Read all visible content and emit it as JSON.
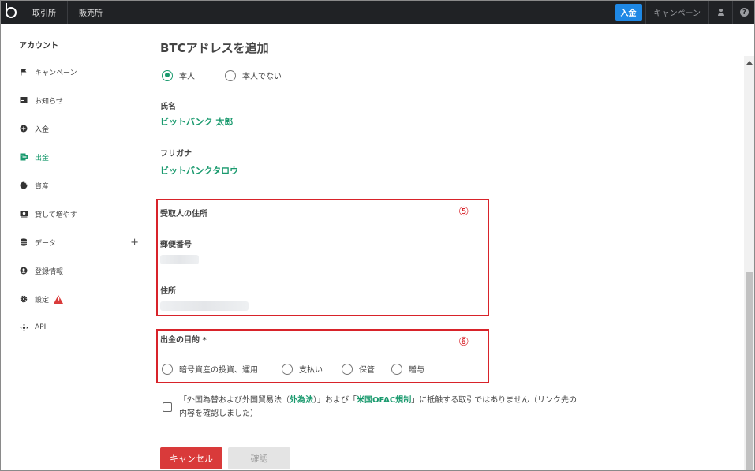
{
  "topbar": {
    "tabs": [
      "取引所",
      "販売所"
    ],
    "deposit_label": "入金",
    "campaign_label": "キャンペーン",
    "help_glyph": "?"
  },
  "sidebar": {
    "title": "アカウント",
    "items": [
      {
        "label": "キャンペーン",
        "icon": "flag-icon"
      },
      {
        "label": "お知らせ",
        "icon": "message-icon"
      },
      {
        "label": "入金",
        "icon": "plus-circle-icon"
      },
      {
        "label": "出金",
        "icon": "withdraw-icon",
        "active": true
      },
      {
        "label": "資産",
        "icon": "pie-chart-icon"
      },
      {
        "label": "貸して増やす",
        "icon": "lending-icon"
      },
      {
        "label": "データ",
        "icon": "database-icon",
        "expand": "+"
      },
      {
        "label": "登録情報",
        "icon": "account-icon"
      },
      {
        "label": "設定",
        "icon": "gear-icon",
        "warning": "!"
      },
      {
        "label": "API",
        "icon": "api-icon"
      }
    ]
  },
  "main": {
    "title": "BTCアドレスを追加",
    "owner_options": [
      "本人",
      "本人でない"
    ],
    "owner_selected": "本人",
    "name_label": "氏名",
    "name_value": "ビットバンク 太郎",
    "kana_label": "フリガナ",
    "kana_value": "ビットバンクタロウ",
    "recipient_address_heading": "受取人の住所",
    "postal_label": "郵便番号",
    "address_label": "住所",
    "annotation_5": "⑤",
    "purpose_label": "出金の目的 *",
    "annotation_6": "⑥",
    "purpose_options": [
      "暗号資産の投資、運用",
      "支払い",
      "保管",
      "贈与"
    ],
    "consent": {
      "prefix": "「外国為替および外国貿易法（",
      "link1": "外為法",
      "middle": "）」および「",
      "link2": "米国OFAC規制",
      "suffix": "」に抵触する取引ではありません（リンク先の内容を確認しました）"
    },
    "cancel_label": "キャンセル",
    "confirm_label": "確認"
  },
  "colors": {
    "accent": "#1a9a6e",
    "topbar": "#202225",
    "deposit": "#1e88e5",
    "danger": "#d93a3a",
    "annotation": "#d8232a"
  }
}
